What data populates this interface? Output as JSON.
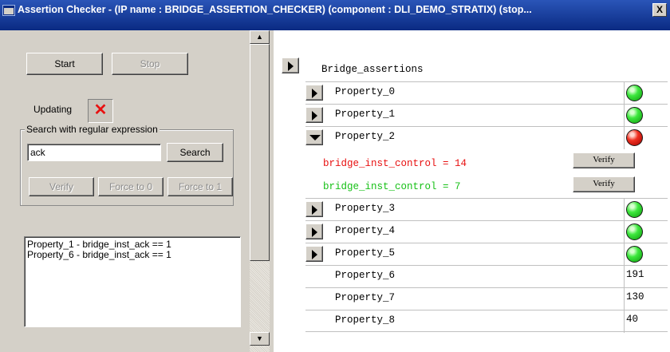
{
  "window": {
    "title": "Assertion Checker - (IP name : BRIDGE_ASSERTION_CHECKER) (component : DLI_DEMO_STRATIX) (stop...",
    "close_label": "X"
  },
  "left": {
    "start_label": "Start",
    "stop_label": "Stop",
    "updating_label": "Updating",
    "updating_status_glyph": "✕",
    "search_group_label": "Search with regular expression",
    "search_value": "ack",
    "search_button_label": "Search",
    "verify_label": "Verify",
    "force0_label": "Force to 0",
    "force1_label": "Force to 1",
    "results": [
      "Property_1 - bridge_inst_ack == 1",
      "Property_6 - bridge_inst_ack == 1"
    ]
  },
  "scrollbar": {
    "up_glyph": "▲",
    "down_glyph": "▼"
  },
  "right": {
    "root_label": "Bridge_assertions",
    "properties": [
      {
        "label": "Property_0",
        "status": "green"
      },
      {
        "label": "Property_1",
        "status": "green"
      },
      {
        "label": "Property_2",
        "status": "red",
        "expanded": true
      },
      {
        "label": "Property_3",
        "status": "green"
      },
      {
        "label": "Property_4",
        "status": "green"
      },
      {
        "label": "Property_5",
        "status": "green"
      },
      {
        "label": "Property_6",
        "value": "191"
      },
      {
        "label": "Property_7",
        "value": "130"
      },
      {
        "label": "Property_8",
        "value": "40"
      }
    ],
    "expanded_lines": [
      {
        "text": "bridge_inst_control = 14",
        "color": "#e81010",
        "button": "Verify"
      },
      {
        "text": "bridge_inst_control = 7",
        "color": "#16c016",
        "button": "Verify"
      }
    ]
  },
  "colors": {
    "title_bar": "#0a2a82",
    "panel": "#d4d0c8",
    "led_green": "#3ee83e",
    "led_red": "#f03020"
  }
}
